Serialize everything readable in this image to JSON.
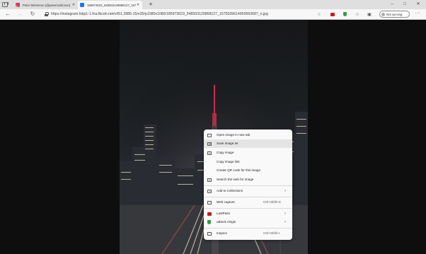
{
  "tabs": [
    {
      "title": "Peter McKinnon (@petermckinnon)",
      "icon": "instagram-icon",
      "active": false
    },
    {
      "title": "185973623_548503129868127_15750396149595",
      "icon": "facebook-icon",
      "active": true
    }
  ],
  "address": {
    "url": "https://instagram.fskp1-1.fna.fbcdn.net/v/t51.2885-15/e35/p1080x1080/185973623_548503129868127_1575039614959563687_n.jpg"
  },
  "profile": {
    "sync_label": "Not syncing"
  },
  "context_menu": {
    "items": [
      {
        "label": "Open image in new tab",
        "icon": "open-new-tab-icon",
        "shortcut": "",
        "submenu": false
      },
      {
        "label": "Save image as",
        "icon": "save-icon",
        "shortcut": "",
        "submenu": false,
        "highlighted": true
      },
      {
        "label": "Copy image",
        "icon": "copy-image-icon",
        "shortcut": "",
        "submenu": false
      },
      {
        "label": "Copy image link",
        "icon": "",
        "shortcut": "",
        "submenu": false
      },
      {
        "label": "Create QR code for this image",
        "icon": "",
        "shortcut": "",
        "submenu": false
      },
      {
        "label": "Search the web for image",
        "icon": "search-image-icon",
        "shortcut": "",
        "submenu": false
      },
      {
        "label": "Add to Collections",
        "icon": "collections-icon",
        "shortcut": "",
        "submenu": true
      },
      {
        "label": "Web capture",
        "icon": "web-capture-icon",
        "shortcut": "Ctrl+Shift+S",
        "submenu": false
      },
      {
        "label": "LastPass",
        "icon": "lastpass-icon",
        "shortcut": "",
        "submenu": true
      },
      {
        "label": "uBlock Origin",
        "icon": "ublock-icon",
        "shortcut": "",
        "submenu": true
      },
      {
        "label": "Inspect",
        "icon": "inspect-icon",
        "shortcut": "Ctrl+Shift+I",
        "submenu": false
      }
    ]
  },
  "colors": {
    "lastpass": "#cc1a1a",
    "ublock": "#2f9e44",
    "highlight": "#e4e4e4",
    "tower_light": "#e0204a"
  }
}
